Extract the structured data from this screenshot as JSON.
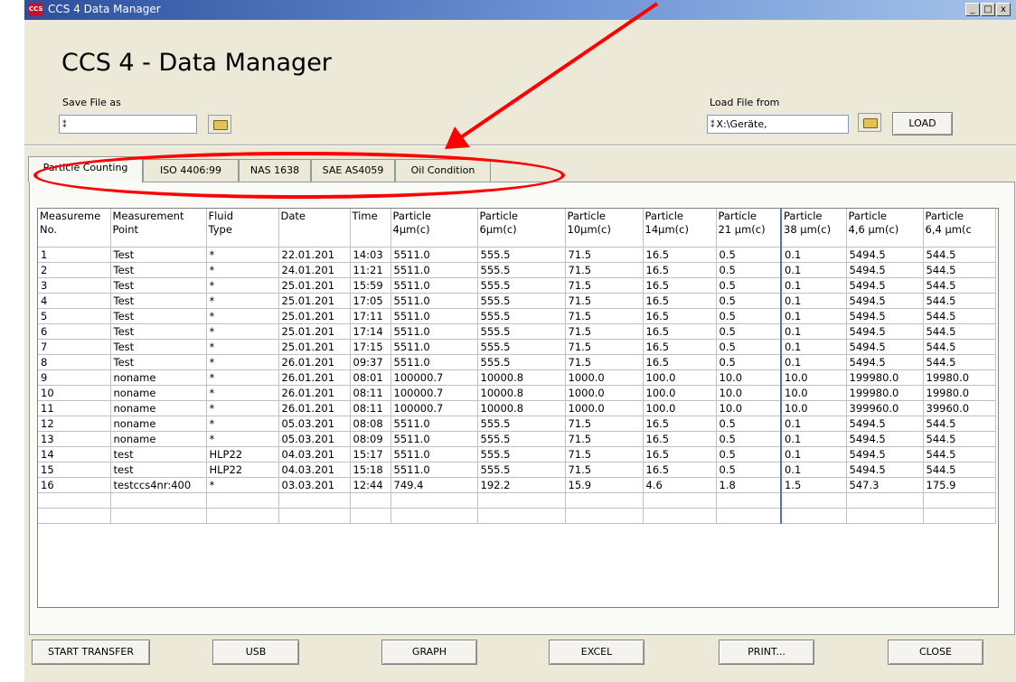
{
  "window": {
    "title": "CCS 4 Data Manager",
    "icon": "app-logo-icon",
    "min_glyph": "_",
    "max_glyph": "□",
    "close_glyph": "x"
  },
  "header": {
    "app_title": "CCS 4 - Data Manager",
    "save": {
      "label": "Save File as",
      "value": ""
    },
    "load": {
      "label": "Load File from",
      "value": "X:\\Geräte,",
      "button": "LOAD"
    }
  },
  "tabs": [
    "Particle Counting",
    "ISO 4406:99",
    "NAS 1638",
    "SAE AS4059",
    "Oil Condition"
  ],
  "active_tab": 0,
  "table": {
    "columns": [
      "Measureme No.",
      "Measurement Point",
      "Fluid Type",
      "Date",
      "Time",
      "Particle 4µm(c)",
      "Particle 6µm(c)",
      "Particle 10µm(c)",
      "Particle 14µm(c)",
      "Particle 21 µm(c)",
      "Particle 38 µm(c)",
      "Particle 4,6 µm(c)",
      "Particle 6,4 µm(c"
    ],
    "header_lines": [
      [
        "Measureme",
        "No."
      ],
      [
        "Measurement",
        "Point"
      ],
      [
        "Fluid",
        "Type"
      ],
      [
        "Date",
        ""
      ],
      [
        "Time",
        ""
      ],
      [
        "Particle",
        "4µm(c)"
      ],
      [
        "Particle",
        "6µm(c)"
      ],
      [
        "Particle",
        "10µm(c)"
      ],
      [
        "Particle",
        "14µm(c)"
      ],
      [
        "Particle",
        "21 µm(c)"
      ],
      [
        "Particle",
        "38 µm(c)"
      ],
      [
        "Particle",
        "4,6 µm(c)"
      ],
      [
        "Particle",
        "6,4 µm(c"
      ]
    ],
    "rows": [
      [
        "1",
        "Test",
        "*",
        "22.01.201",
        "14:03",
        "5511.0",
        "555.5",
        "71.5",
        "16.5",
        "0.5",
        "0.1",
        "5494.5",
        "544.5"
      ],
      [
        "2",
        "Test",
        "*",
        "24.01.201",
        "11:21",
        "5511.0",
        "555.5",
        "71.5",
        "16.5",
        "0.5",
        "0.1",
        "5494.5",
        "544.5"
      ],
      [
        "3",
        "Test",
        "*",
        "25.01.201",
        "15:59",
        "5511.0",
        "555.5",
        "71.5",
        "16.5",
        "0.5",
        "0.1",
        "5494.5",
        "544.5"
      ],
      [
        "4",
        "Test",
        "*",
        "25.01.201",
        "17:05",
        "5511.0",
        "555.5",
        "71.5",
        "16.5",
        "0.5",
        "0.1",
        "5494.5",
        "544.5"
      ],
      [
        "5",
        "Test",
        "*",
        "25.01.201",
        "17:11",
        "5511.0",
        "555.5",
        "71.5",
        "16.5",
        "0.5",
        "0.1",
        "5494.5",
        "544.5"
      ],
      [
        "6",
        "Test",
        "*",
        "25.01.201",
        "17:14",
        "5511.0",
        "555.5",
        "71.5",
        "16.5",
        "0.5",
        "0.1",
        "5494.5",
        "544.5"
      ],
      [
        "7",
        "Test",
        "*",
        "25.01.201",
        "17:15",
        "5511.0",
        "555.5",
        "71.5",
        "16.5",
        "0.5",
        "0.1",
        "5494.5",
        "544.5"
      ],
      [
        "8",
        "Test",
        "*",
        "26.01.201",
        "09:37",
        "5511.0",
        "555.5",
        "71.5",
        "16.5",
        "0.5",
        "0.1",
        "5494.5",
        "544.5"
      ],
      [
        "9",
        "noname",
        "*",
        "26.01.201",
        "08:01",
        "100000.7",
        "10000.8",
        "1000.0",
        "100.0",
        "10.0",
        "10.0",
        "199980.0",
        "19980.0"
      ],
      [
        "10",
        "noname",
        "*",
        "26.01.201",
        "08:11",
        "100000.7",
        "10000.8",
        "1000.0",
        "100.0",
        "10.0",
        "10.0",
        "199980.0",
        "19980.0"
      ],
      [
        "11",
        "noname",
        "*",
        "26.01.201",
        "08:11",
        "100000.7",
        "10000.8",
        "1000.0",
        "100.0",
        "10.0",
        "10.0",
        "399960.0",
        "39960.0"
      ],
      [
        "12",
        "noname",
        "*",
        "05.03.201",
        "08:08",
        "5511.0",
        "555.5",
        "71.5",
        "16.5",
        "0.5",
        "0.1",
        "5494.5",
        "544.5"
      ],
      [
        "13",
        "noname",
        "*",
        "05.03.201",
        "08:09",
        "5511.0",
        "555.5",
        "71.5",
        "16.5",
        "0.5",
        "0.1",
        "5494.5",
        "544.5"
      ],
      [
        "14",
        "test",
        "HLP22",
        "04.03.201",
        "15:17",
        "5511.0",
        "555.5",
        "71.5",
        "16.5",
        "0.5",
        "0.1",
        "5494.5",
        "544.5"
      ],
      [
        "15",
        "test",
        "HLP22",
        "04.03.201",
        "15:18",
        "5511.0",
        "555.5",
        "71.5",
        "16.5",
        "0.5",
        "0.1",
        "5494.5",
        "544.5"
      ],
      [
        "16",
        "testccs4nr:400",
        "*",
        "03.03.201",
        "12:44",
        "749.4",
        "192.2",
        "15.9",
        "4.6",
        "1.8",
        "1.5",
        "547.3",
        "175.9"
      ],
      [
        "",
        "",
        "",
        "",
        "",
        "",
        "",
        "",
        "",
        "",
        "",
        "",
        ""
      ],
      [
        "",
        "",
        "",
        "",
        "",
        "",
        "",
        "",
        "",
        "",
        "",
        "",
        ""
      ]
    ]
  },
  "buttons": [
    "START TRANSFER",
    "USB",
    "GRAPH",
    "EXCEL",
    "PRINT...",
    "CLOSE"
  ],
  "colors": {
    "annotation": "#ff0000",
    "titlebar": "#2c4f9d",
    "window_bg": "#ece9d8"
  },
  "annotation": {
    "shape": "ellipse around tab strip with arrow",
    "color": "#ff0000"
  }
}
